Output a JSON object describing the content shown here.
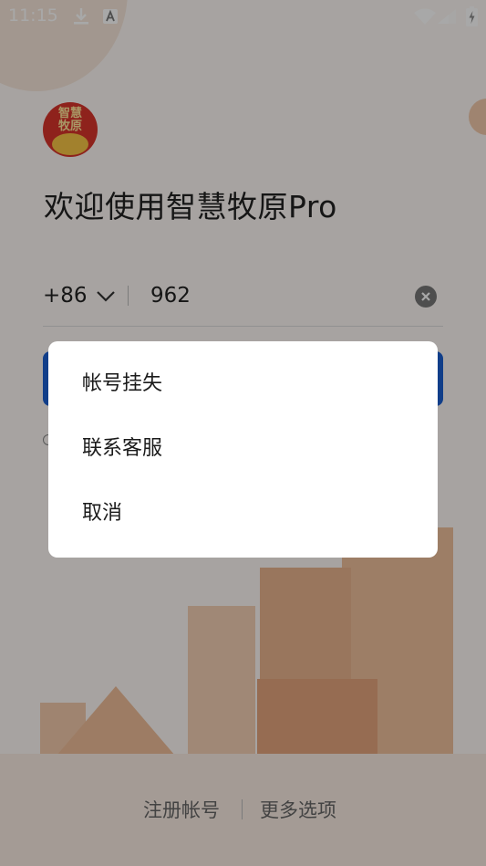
{
  "status_bar": {
    "time": "11:15",
    "icons": [
      "download-icon",
      "text-a-icon",
      "wifi-icon",
      "signal-icon",
      "battery-charging-icon"
    ]
  },
  "app": {
    "logo_text": "智慧牧原",
    "welcome": "欢迎使用智慧牧原Pro"
  },
  "login": {
    "country_code": "+86",
    "phone_value": "962"
  },
  "footer": {
    "register": "注册帐号",
    "more_options": "更多选项"
  },
  "dialog": {
    "options": [
      "帐号挂失",
      "联系客服",
      "取消"
    ]
  },
  "colors": {
    "primary": "#1a5fd1",
    "overlay": "#000000"
  }
}
